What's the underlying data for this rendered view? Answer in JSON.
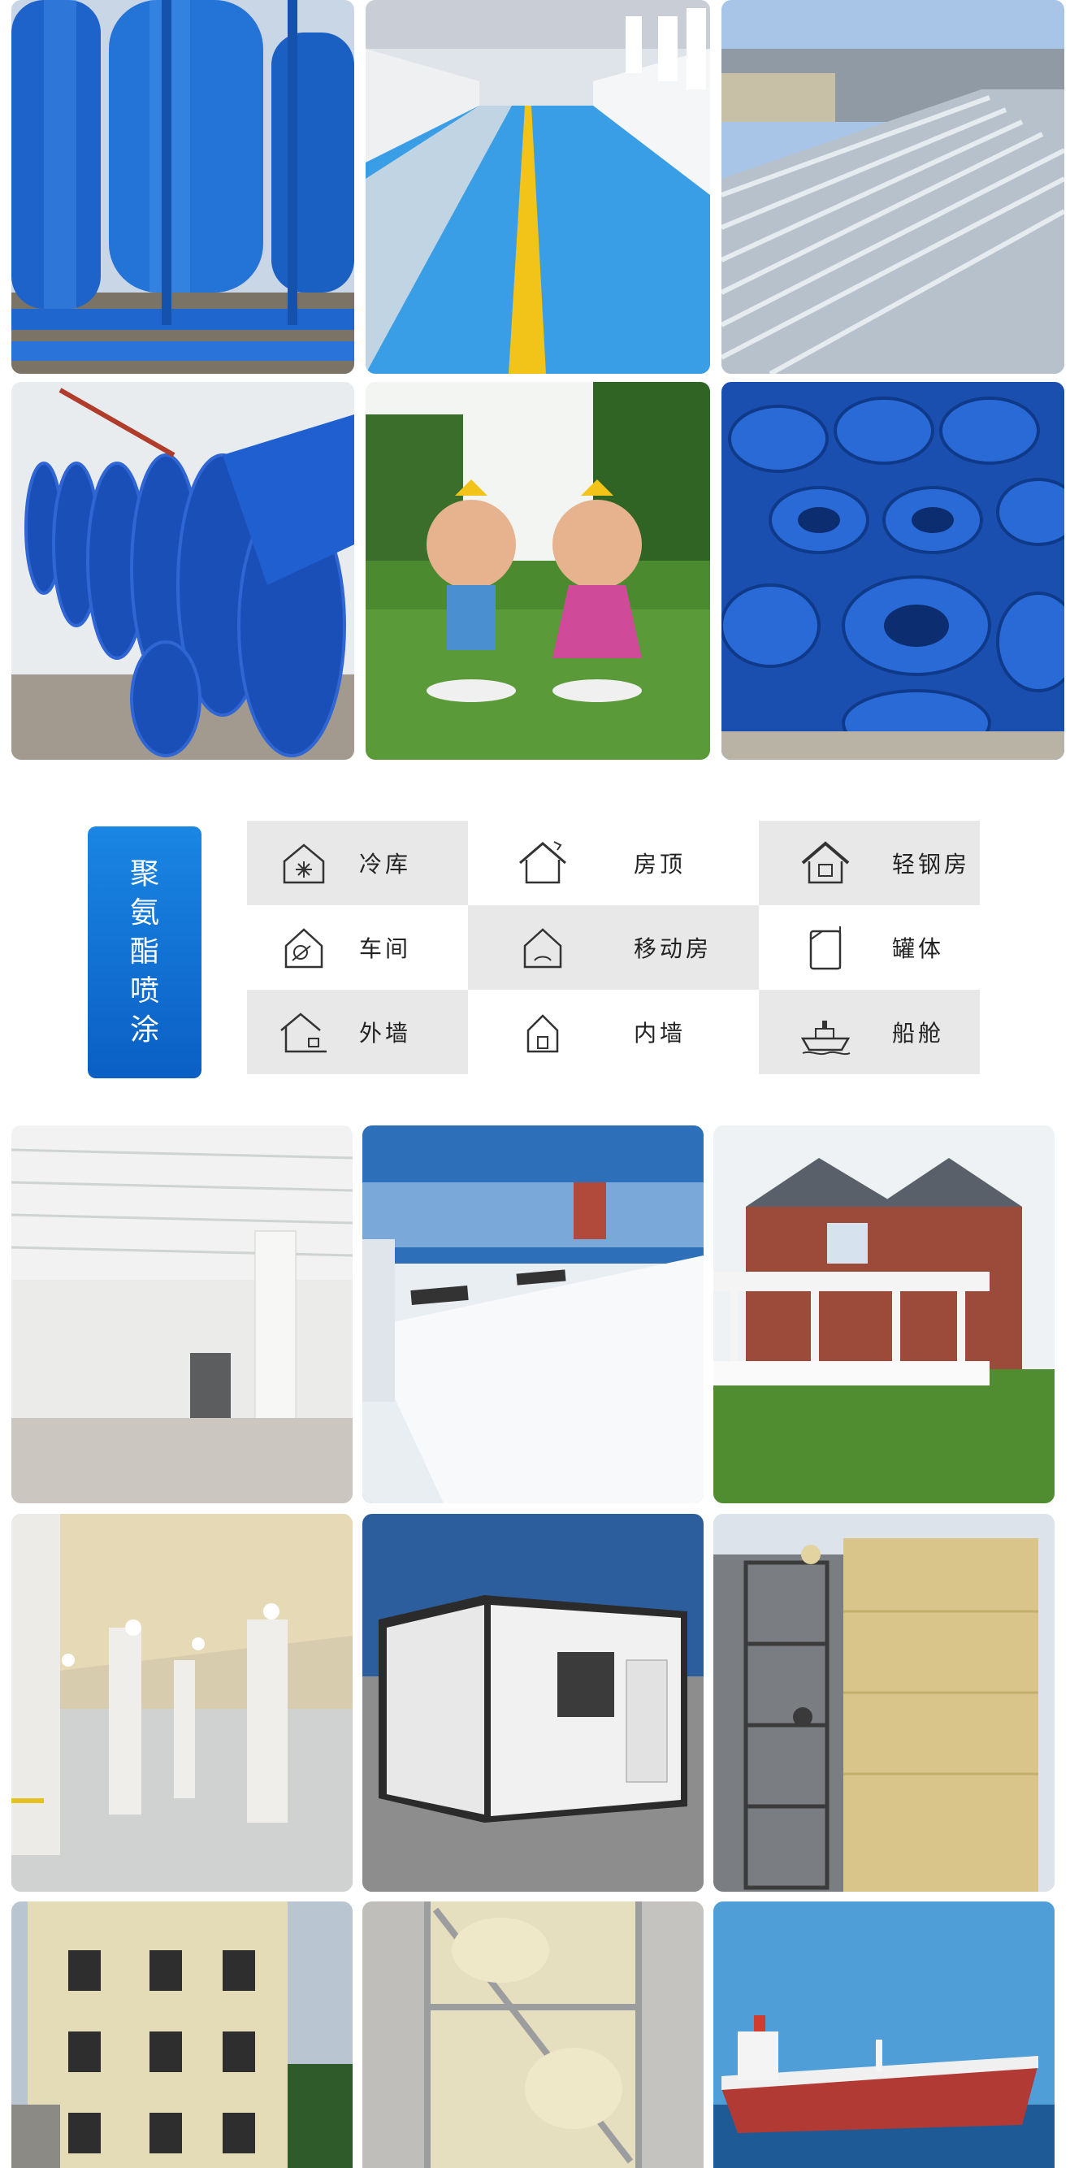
{
  "section": {
    "title": "聚氨酯喷涂",
    "categories": [
      {
        "label": "冷库",
        "icon": "cold-storage-icon"
      },
      {
        "label": "房顶",
        "icon": "roof-icon"
      },
      {
        "label": "轻钢房",
        "icon": "light-steel-house-icon"
      },
      {
        "label": "车间",
        "icon": "workshop-icon"
      },
      {
        "label": "移动房",
        "icon": "mobile-house-icon"
      },
      {
        "label": "罐体",
        "icon": "tank-icon"
      },
      {
        "label": "外墙",
        "icon": "exterior-wall-icon"
      },
      {
        "label": "内墙",
        "icon": "interior-wall-icon"
      },
      {
        "label": "船舱",
        "icon": "ship-cabin-icon"
      }
    ]
  },
  "colors": {
    "accent_blue": "#0b6fd6",
    "cell_gray": "#e8e8e8",
    "foam_yellow": "#e8dca8"
  }
}
